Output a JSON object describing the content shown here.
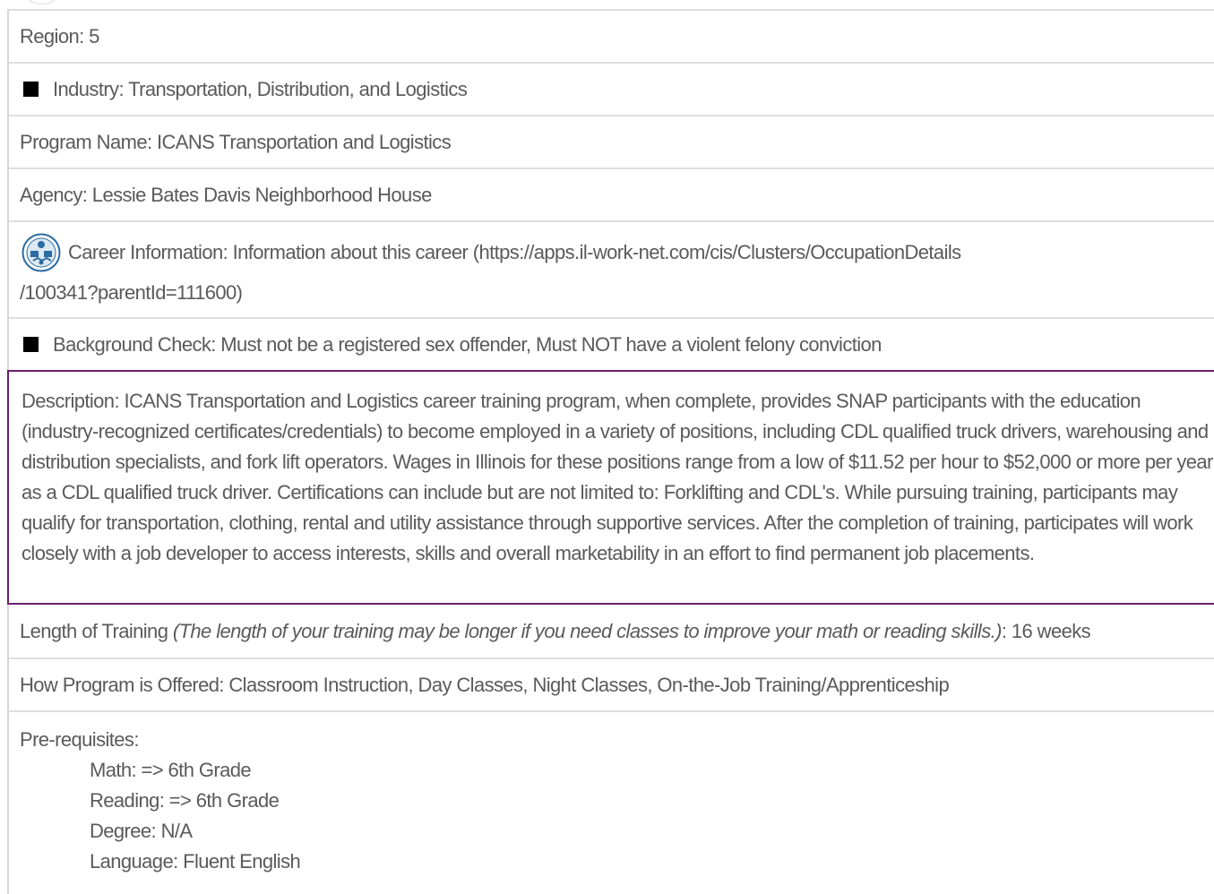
{
  "fields": {
    "region": "Region: 5",
    "industry": "Industry: Transportation, Distribution, and Logistics",
    "program_name": "Program Name: ICANS Transportation and Logistics",
    "agency": "Agency: Lessie Bates Davis Neighborhood House",
    "career_info_line1": "Career Information: Information about this career (https://apps.il-work-net.com/cis/Clusters/OccupationDetails",
    "career_info_line2": "/100341?parentId=111600)",
    "background_check": "Background Check: Must not be a registered sex offender, Must NOT have a violent felony conviction",
    "description": "Description: ICANS Transportation and Logistics career training program, when complete, provides SNAP participants with the education (industry-recognized certificates/credentials) to become employed in a variety of positions, including CDL qualified truck drivers, warehousing and distribution specialists, and fork lift operators. Wages in Illinois for these positions range from a low of $11.52 per hour to $52,000 or more per year as a CDL qualified truck driver. Certifications can include but are not limited to: Forklifting and CDL's. While pursuing training, participants may qualify for transportation, clothing, rental and utility assistance through supportive services. After the completion of training, participates will work closely with a job developer to access interests, skills and overall marketability in an effort to find permanent job placements.",
    "length_label": "Length of Training ",
    "length_note": "(The length of your training may be longer if you need classes to improve your math or reading skills.)",
    "length_value": ": 16 weeks",
    "offered": "How Program is Offered: Classroom Instruction, Day Classes, Night Classes, On-the-Job Training/Apprenticeship",
    "prereq_label": "Pre-requisites:",
    "prereq_items": [
      "Math: => 6th Grade",
      "Reading: => 6th Grade",
      "Degree: N/A",
      "Language: Fluent English"
    ]
  },
  "icons": {
    "bullet": "black-square-icon",
    "career": "career-cluster-icon"
  },
  "colors": {
    "text": "#5a5a5a",
    "divider": "#dedede",
    "highlight_border": "#6b1f6e",
    "icon_blue": "#2b6ca3"
  }
}
